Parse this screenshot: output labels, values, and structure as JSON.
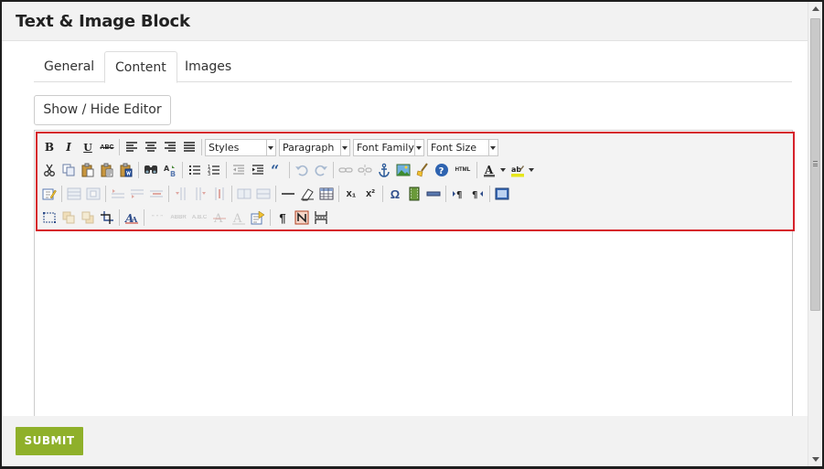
{
  "dialog": {
    "title": "Text & Image Block"
  },
  "tabs": [
    {
      "label": "General"
    },
    {
      "label": "Content",
      "active": true
    },
    {
      "label": "Images"
    }
  ],
  "toggle_editor_label": "Show / Hide Editor",
  "toolbar": {
    "selects": {
      "styles": "Styles",
      "format": "Paragraph",
      "font_family": "Font Family",
      "font_size": "Font Size"
    },
    "icons": {
      "bold": "B",
      "italic": "I",
      "underline": "U",
      "strikethrough": "ABC",
      "html": "HTML",
      "superscript": "x²",
      "subscript": "x₁",
      "omega": "Ω",
      "pilcrow": "¶"
    }
  },
  "footer": {
    "submit_label": "SUBMIT"
  },
  "colors": {
    "highlight": "#d6222b",
    "submit": "#8fb02a"
  }
}
